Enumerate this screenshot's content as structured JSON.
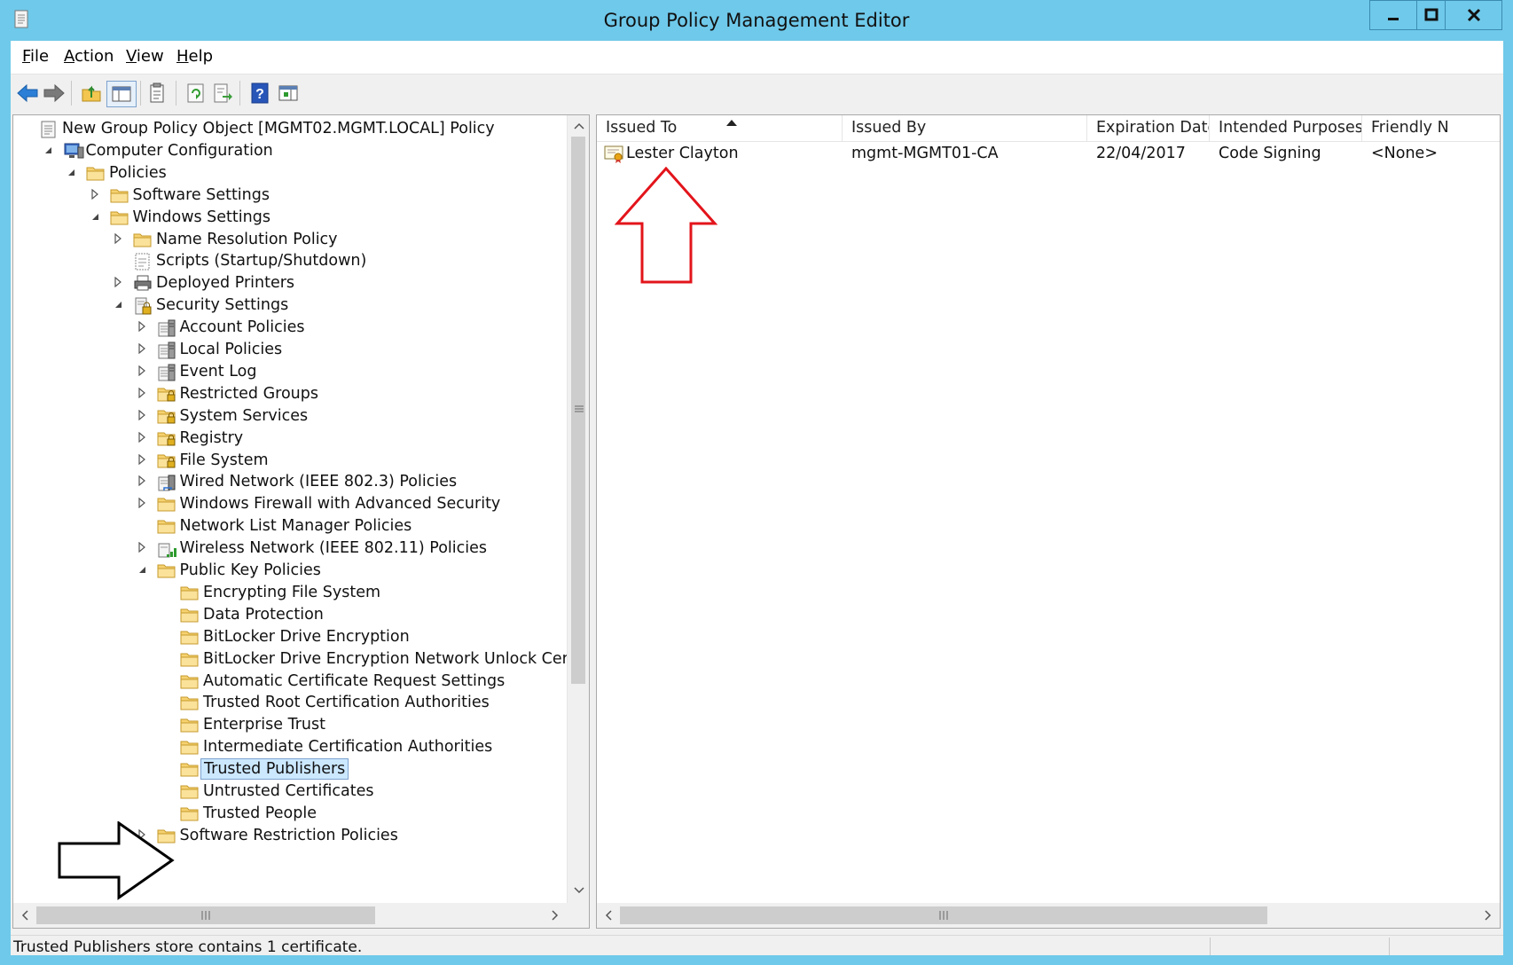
{
  "window": {
    "title": "Group Policy Management Editor",
    "controls": {
      "minimize": "minimize",
      "maximize": "maximize",
      "close": "close"
    }
  },
  "menu": {
    "items": [
      {
        "label": "File",
        "accel": "F",
        "rest": "ile"
      },
      {
        "label": "Action",
        "accel": "A",
        "rest": "ction"
      },
      {
        "label": "View",
        "accel": "V",
        "rest": "iew"
      },
      {
        "label": "Help",
        "accel": "H",
        "rest": "elp"
      }
    ]
  },
  "toolbar": {
    "buttons": [
      "back-icon",
      "forward-icon",
      "up-folder-icon",
      "show-hide-console-tree-icon",
      "properties-icon",
      "refresh-icon",
      "export-list-icon",
      "help-icon",
      "show-action-pane-icon"
    ]
  },
  "tree": {
    "items": [
      {
        "label": "New Group Policy Object [MGMT02.MGMT.LOCAL] Policy",
        "level": 0,
        "expander": "none",
        "icon": "policy-document-icon"
      },
      {
        "label": "Computer Configuration",
        "level": 1,
        "expander": "expanded",
        "icon": "computer-icon"
      },
      {
        "label": "Policies",
        "level": 2,
        "expander": "expanded",
        "icon": "folder-icon"
      },
      {
        "label": "Software Settings",
        "level": 3,
        "expander": "collapsed",
        "icon": "folder-icon"
      },
      {
        "label": "Windows Settings",
        "level": 3,
        "expander": "expanded",
        "icon": "folder-icon"
      },
      {
        "label": "Name Resolution Policy",
        "level": 4,
        "expander": "collapsed",
        "icon": "folder-icon"
      },
      {
        "label": "Scripts (Startup/Shutdown)",
        "level": 4,
        "expander": "none",
        "icon": "script-icon"
      },
      {
        "label": "Deployed Printers",
        "level": 4,
        "expander": "collapsed",
        "icon": "printer-icon"
      },
      {
        "label": "Security Settings",
        "level": 4,
        "expander": "expanded",
        "icon": "security-settings-icon"
      },
      {
        "label": "Account Policies",
        "level": 5,
        "expander": "collapsed",
        "icon": "policy-server-icon"
      },
      {
        "label": "Local Policies",
        "level": 5,
        "expander": "collapsed",
        "icon": "policy-server-icon"
      },
      {
        "label": "Event Log",
        "level": 5,
        "expander": "collapsed",
        "icon": "policy-server-icon"
      },
      {
        "label": "Restricted Groups",
        "level": 5,
        "expander": "collapsed",
        "icon": "locked-folder-icon"
      },
      {
        "label": "System Services",
        "level": 5,
        "expander": "collapsed",
        "icon": "locked-folder-icon"
      },
      {
        "label": "Registry",
        "level": 5,
        "expander": "collapsed",
        "icon": "locked-folder-icon"
      },
      {
        "label": "File System",
        "level": 5,
        "expander": "collapsed",
        "icon": "locked-folder-icon"
      },
      {
        "label": "Wired Network (IEEE 802.3) Policies",
        "level": 5,
        "expander": "collapsed",
        "icon": "wired-network-icon"
      },
      {
        "label": "Windows Firewall with Advanced Security",
        "level": 5,
        "expander": "collapsed",
        "icon": "folder-icon"
      },
      {
        "label": "Network List Manager Policies",
        "level": 5,
        "expander": "none",
        "icon": "folder-icon"
      },
      {
        "label": "Wireless Network (IEEE 802.11) Policies",
        "level": 5,
        "expander": "collapsed",
        "icon": "wireless-network-icon"
      },
      {
        "label": "Public Key Policies",
        "level": 5,
        "expander": "expanded",
        "icon": "folder-icon"
      },
      {
        "label": "Encrypting File System",
        "level": 6,
        "expander": "none",
        "icon": "folder-icon"
      },
      {
        "label": "Data Protection",
        "level": 6,
        "expander": "none",
        "icon": "folder-icon"
      },
      {
        "label": "BitLocker Drive Encryption",
        "level": 6,
        "expander": "none",
        "icon": "folder-icon"
      },
      {
        "label": "BitLocker Drive Encryption Network Unlock Certificat",
        "level": 6,
        "expander": "none",
        "icon": "folder-icon"
      },
      {
        "label": "Automatic Certificate Request Settings",
        "level": 6,
        "expander": "none",
        "icon": "folder-icon"
      },
      {
        "label": "Trusted Root Certification Authorities",
        "level": 6,
        "expander": "none",
        "icon": "folder-icon"
      },
      {
        "label": "Enterprise Trust",
        "level": 6,
        "expander": "none",
        "icon": "folder-icon"
      },
      {
        "label": "Intermediate Certification Authorities",
        "level": 6,
        "expander": "none",
        "icon": "folder-icon"
      },
      {
        "label": "Trusted Publishers",
        "level": 6,
        "expander": "none",
        "icon": "folder-icon",
        "selected": true
      },
      {
        "label": "Untrusted Certificates",
        "level": 6,
        "expander": "none",
        "icon": "folder-icon"
      },
      {
        "label": "Trusted People",
        "level": 6,
        "expander": "none",
        "icon": "folder-icon"
      },
      {
        "label": "Software Restriction Policies",
        "level": 5,
        "expander": "collapsed",
        "icon": "folder-icon"
      }
    ]
  },
  "list": {
    "columns": [
      "Issued To",
      "Issued By",
      "Expiration Date",
      "Intended Purposes",
      "Friendly N"
    ],
    "sort_column": "Issued To",
    "rows": [
      {
        "issued_to": "Lester Clayton",
        "issued_by": "mgmt-MGMT01-CA",
        "expiration": "22/04/2017",
        "purposes": "Code Signing",
        "friendly": "<None>",
        "icon": "certificate-icon"
      }
    ]
  },
  "annotations": {
    "up_arrow_color": "#e3141b",
    "right_arrow_color": "#000000"
  },
  "status": {
    "text": "Trusted Publishers store contains 1 certificate."
  }
}
